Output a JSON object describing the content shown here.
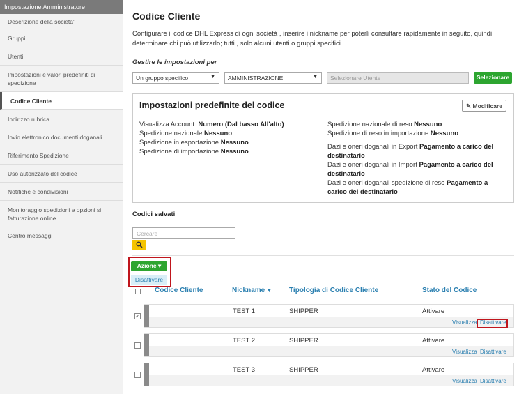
{
  "sidebar": {
    "header": "Impostazione Amministratore",
    "items": [
      {
        "label": "Descrizione della societa'"
      },
      {
        "label": "Gruppi"
      },
      {
        "label": "Utenti"
      },
      {
        "label": "Impostazioni e valori predefiniti di spedizione"
      },
      {
        "label": "Codice Cliente"
      },
      {
        "label": "Indirizzo rubrica"
      },
      {
        "label": "Invio elettronico documenti doganali"
      },
      {
        "label": "Riferimento Spedizione"
      },
      {
        "label": "Uso autorizzato del codice"
      },
      {
        "label": "Notifiche e condivisioni"
      },
      {
        "label": "Monitoraggio spedizioni e opzioni si fatturazione online"
      },
      {
        "label": "Centro messaggi"
      }
    ]
  },
  "main": {
    "title": "Codice Cliente",
    "intro": "Configurare il codice DHL Express di ogni società , inserire i nickname per poterli consultare rapidamente in seguito, quindi determinare chi può utilizzarlo; tutti , solo alcuni utenti o gruppi specifici.",
    "manage_label": "Gestire le impostazioni per",
    "scope_select": "Un gruppo specifico",
    "group_select": "AMMINISTRAZIONE",
    "user_placeholder": "Selezionare Utente",
    "select_button": "Selezionare"
  },
  "defaults": {
    "title": "Impostazioni predefinite del codice",
    "modify_label": "Modificare",
    "left": [
      {
        "k": "Visualizza Account: ",
        "v": "Numero (Dal basso All'alto)"
      },
      {
        "k": "Spedizione nazionale ",
        "v": "Nessuno"
      },
      {
        "k": "Spedizione in esportazione ",
        "v": "Nessuno"
      },
      {
        "k": "Spedizione di importazione ",
        "v": "Nessuno"
      }
    ],
    "right": [
      {
        "k": "Spedizione nazionale di reso ",
        "v": "Nessuno"
      },
      {
        "k": "Spedizione di reso in importazione ",
        "v": "Nessuno"
      },
      {
        "k": "Dazi e oneri doganali in Export ",
        "v": "Pagamento a carico del destinatario"
      },
      {
        "k": "Dazi e oneri doganali in Import ",
        "v": "Pagamento a carico del destinatario"
      },
      {
        "k": "Dazi e oneri doganali spedizione di reso ",
        "v": "Pagamento a carico del destinatario"
      }
    ]
  },
  "saved": {
    "title": "Codici salvati",
    "search_placeholder": "Cercare",
    "action_label": "Azione",
    "action_menu": "Disattivare",
    "columns": [
      "Codice Cliente",
      "Nickname",
      "Tipologia di Codice Cliente",
      "Stato del Codice"
    ],
    "rows": [
      {
        "nickname": "TEST 1",
        "type": "SHIPPER",
        "status": "Attivare",
        "checked": true
      },
      {
        "nickname": "TEST 2",
        "type": "SHIPPER",
        "status": "Attivare",
        "checked": false
      },
      {
        "nickname": "TEST 3",
        "type": "SHIPPER",
        "status": "Attivare",
        "checked": false
      }
    ],
    "view_link": "Visualizza",
    "deactivate_link": "Disattivare"
  },
  "colors": {
    "accent_green": "#2da530",
    "link_blue": "#2a7fb0",
    "highlight_red": "#c0161d",
    "search_yellow": "#f5c400"
  }
}
